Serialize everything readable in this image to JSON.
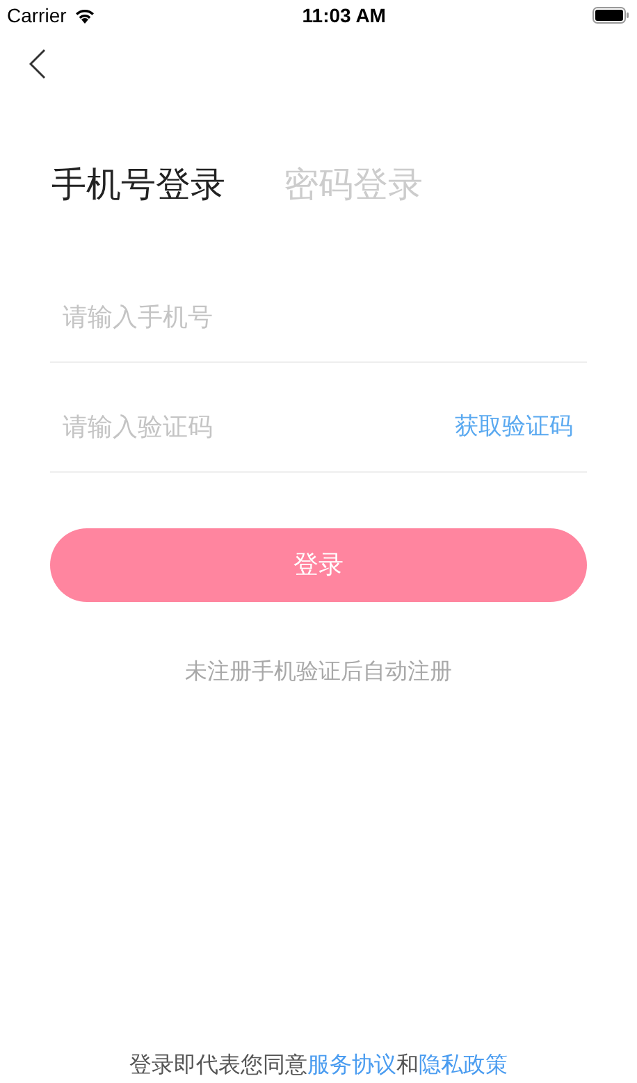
{
  "status_bar": {
    "carrier": "Carrier",
    "time": "11:03 AM"
  },
  "tabs": [
    {
      "label": "手机号登录",
      "selected": true
    },
    {
      "label": "密码登录",
      "selected": false
    }
  ],
  "phone_field": {
    "placeholder": "请输入手机号"
  },
  "code_field": {
    "placeholder": "请输入验证码",
    "action": "获取验证码"
  },
  "login_button": "登录",
  "note": "未注册手机验证后自动注册",
  "agreement": {
    "prefix": "登录即代表您同意",
    "terms_link": "服务协议",
    "conjunction": "和",
    "privacy_link": "隐私政策"
  }
}
